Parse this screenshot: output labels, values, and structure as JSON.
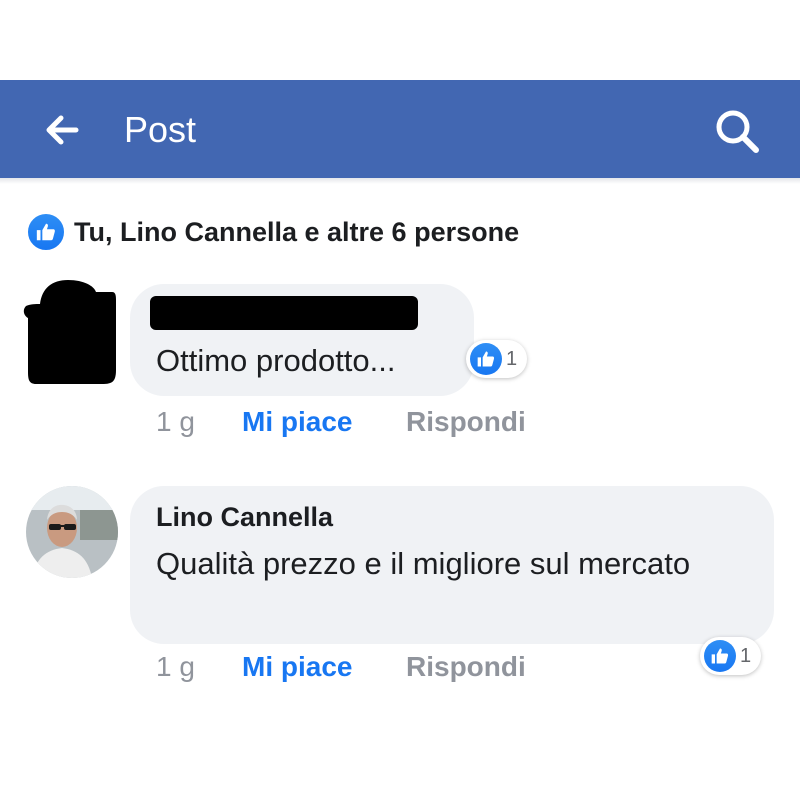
{
  "header": {
    "title": "Post",
    "bg_color": "#4267b2",
    "back_icon": "arrow-left-icon",
    "search_icon": "search-icon"
  },
  "likes_summary": {
    "icon": "thumbs-up-icon",
    "text": "Tu, Lino Cannella e altre 6 persone"
  },
  "comments": [
    {
      "author": "",
      "author_redacted": true,
      "avatar_redacted": true,
      "text": "Ottimo prodotto...",
      "reaction_count": "1",
      "time": "1 g",
      "like_label": "Mi piace",
      "reply_label": "Rispondi"
    },
    {
      "author": "Lino Cannella",
      "author_redacted": false,
      "avatar_redacted": false,
      "text": "Qualità prezzo e il migliore sul mercato",
      "reaction_count": "1",
      "time": "1 g",
      "like_label": "Mi piace",
      "reply_label": "Rispondi"
    }
  ],
  "colors": {
    "accent": "#1877f2",
    "bubble": "#f0f2f5",
    "muted_text": "#90949c",
    "primary_text": "#1c1e21"
  }
}
